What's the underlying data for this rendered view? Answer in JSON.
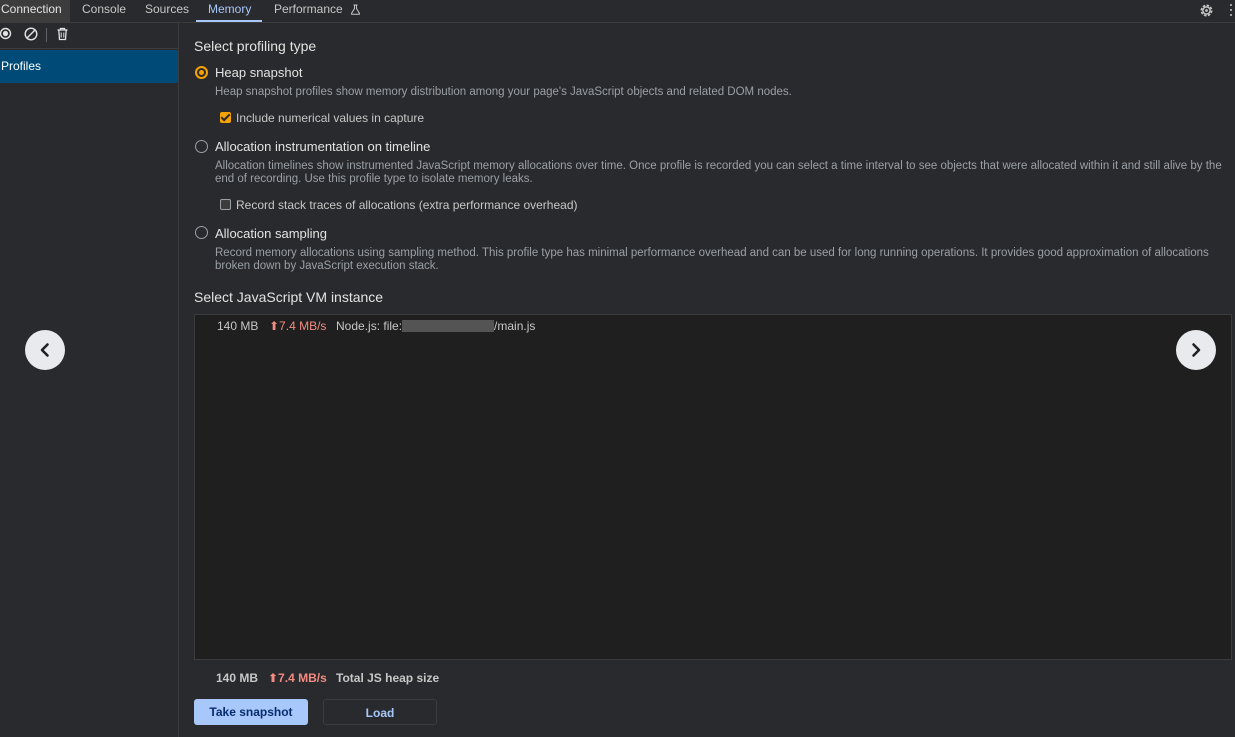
{
  "tabs": [
    {
      "label": "Connection"
    },
    {
      "label": "Console"
    },
    {
      "label": "Sources"
    },
    {
      "label": "Memory"
    },
    {
      "label": "Performance"
    }
  ],
  "active_tab": "Memory",
  "sidebar": {
    "toolbar_icons": [
      "record-icon",
      "clear-icon",
      "trash-icon"
    ],
    "items": [
      {
        "label": "Profiles"
      }
    ]
  },
  "profiling": {
    "heading": "Select profiling type",
    "options": [
      {
        "label": "Heap snapshot",
        "selected": true,
        "description": "Heap snapshot profiles show memory distribution among your page's JavaScript objects and related DOM nodes.",
        "checkbox": {
          "label": "Include numerical values in capture",
          "checked": true
        }
      },
      {
        "label": "Allocation instrumentation on timeline",
        "selected": false,
        "description": "Allocation timelines show instrumented JavaScript memory allocations over time. Once profile is recorded you can select a time interval to see objects that were allocated within it and still alive by the end of recording. Use this profile type to isolate memory leaks.",
        "checkbox": {
          "label": "Record stack traces of allocations (extra performance overhead)",
          "checked": false
        }
      },
      {
        "label": "Allocation sampling",
        "selected": false,
        "description": "Record memory allocations using sampling method. This profile type has minimal performance overhead and can be used for long running operations. It provides good approximation of allocations broken down by JavaScript execution stack."
      }
    ]
  },
  "vm": {
    "heading": "Select JavaScript VM instance",
    "instances": [
      {
        "size": "140 MB",
        "rate": "⬆7.4 MB/s",
        "name_prefix": "Node.js: file:",
        "name_suffix": "/main.js"
      }
    ]
  },
  "totals": {
    "size": "140 MB",
    "rate": "⬆7.4 MB/s",
    "label": "Total JS heap size"
  },
  "buttons": {
    "take_snapshot": "Take snapshot",
    "load": "Load"
  },
  "colors": {
    "accent": "#a8c7fa",
    "radio_selected": "#f6a200",
    "rate_red": "#f28b82",
    "sidebar_selected": "#004a77"
  }
}
